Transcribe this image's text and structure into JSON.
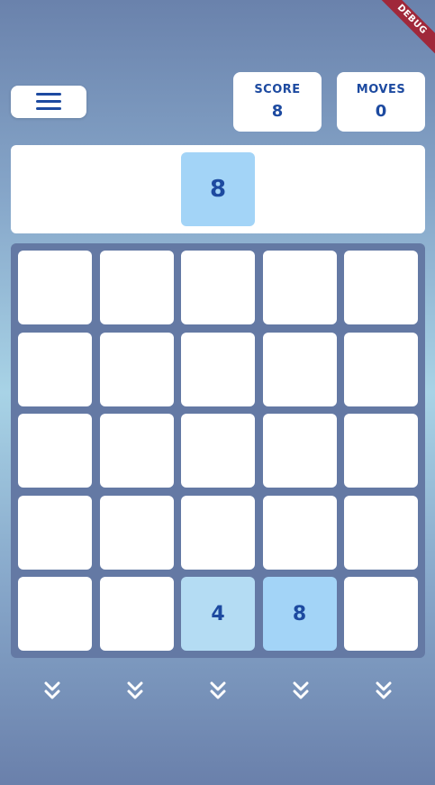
{
  "debug_banner": "DEBUG",
  "stats": {
    "score_label": "SCORE",
    "score_value": "8",
    "moves_label": "MOVES",
    "moves_value": "0"
  },
  "next_tile": {
    "value": "8"
  },
  "board": {
    "rows": [
      [
        "",
        "",
        "",
        "",
        ""
      ],
      [
        "",
        "",
        "",
        "",
        ""
      ],
      [
        "",
        "",
        "",
        "",
        ""
      ],
      [
        "",
        "",
        "",
        "",
        ""
      ],
      [
        "",
        "",
        "4",
        "8",
        ""
      ]
    ]
  },
  "icons": {
    "menu": "hamburger-menu-icon",
    "drop": "double-chevron-down-icon"
  },
  "colors": {
    "accent": "#1d4aa0",
    "tile_4": "#b4dcf3",
    "tile_8": "#a3d4f7",
    "board_bg": "#6479a4",
    "debug": "#a0283a"
  }
}
